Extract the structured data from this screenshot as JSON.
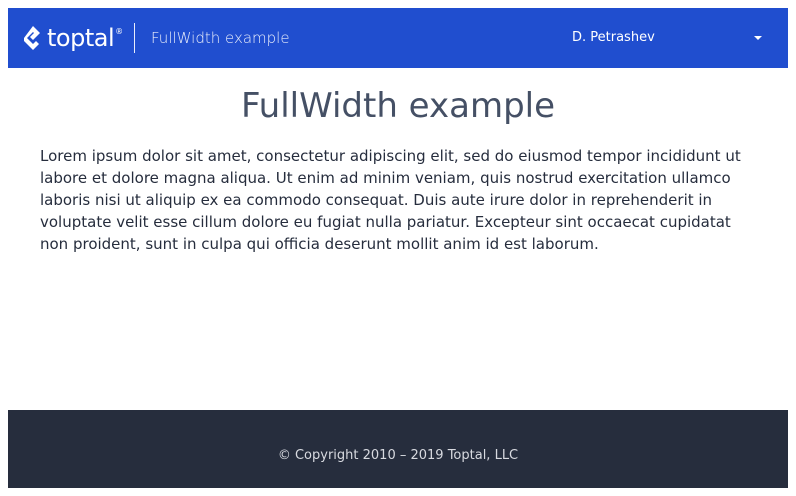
{
  "header": {
    "logo_text": "toptal",
    "logo_reg": "®",
    "logo_icon": "toptal-diamond-icon",
    "title": "FullWidth example",
    "user_name": "D. Petrashev",
    "dropdown_icon": "caret-down-icon"
  },
  "main": {
    "title": "FullWidth example",
    "paragraph": "Lorem ipsum dolor sit amet, consectetur adipiscing elit, sed do eiusmod tempor incididunt ut labore et dolore magna aliqua. Ut enim ad minim veniam, quis nostrud exercitation ullamco laboris nisi ut aliquip ex ea commodo consequat. Duis aute irure dolor in reprehenderit in voluptate velit esse cillum dolore eu fugiat nulla pariatur. Excepteur sint occaecat cupidatat non proident, sunt in culpa qui officia deserunt mollit anim id est laborum."
  },
  "footer": {
    "copyright": "© Copyright 2010 – 2019 Toptal, LLC"
  },
  "colors": {
    "header_bg": "#204ecf",
    "footer_bg": "#262d3d",
    "title_text": "#455065",
    "body_text": "#262d3d"
  }
}
